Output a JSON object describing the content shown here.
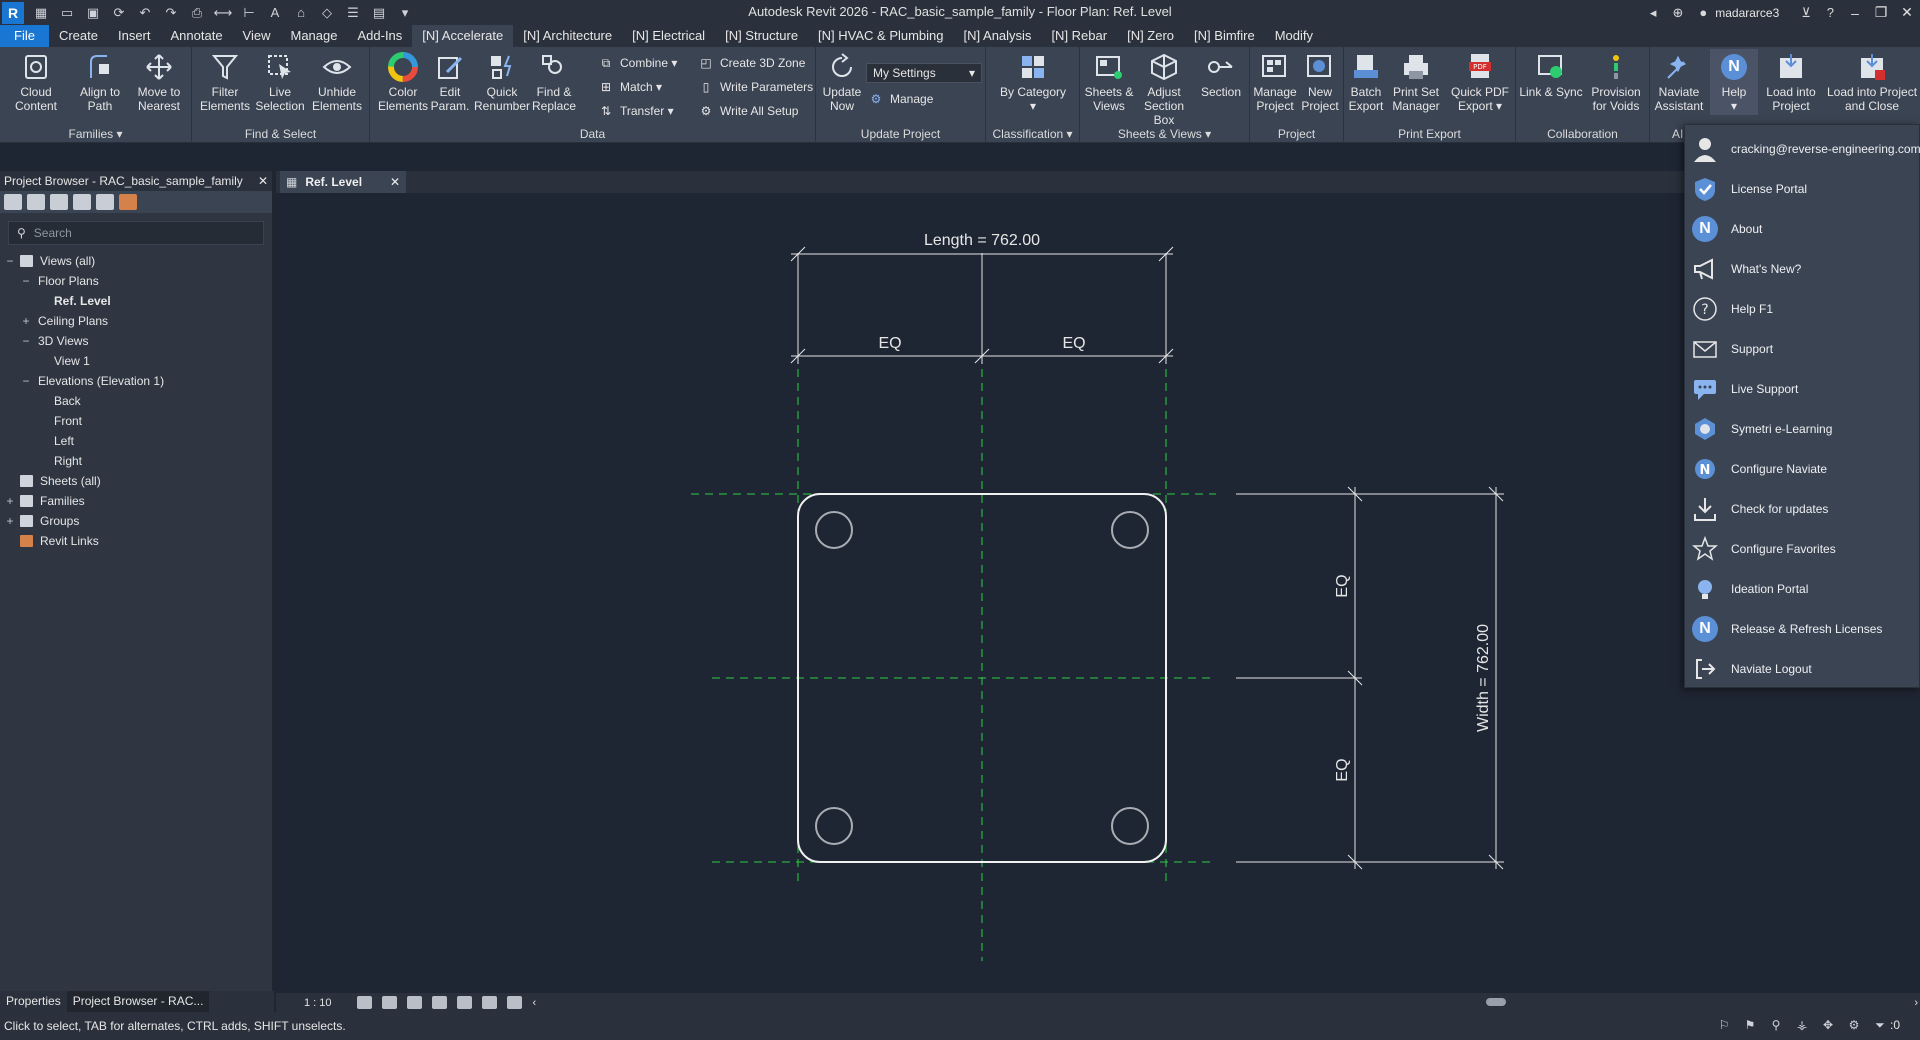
{
  "window": {
    "title": "Autodesk Revit 2026 - RAC_basic_sample_family - Floor Plan: Ref. Level",
    "user": "madararce3"
  },
  "menu_tabs": [
    "File",
    "Create",
    "Insert",
    "Annotate",
    "View",
    "Manage",
    "Add-Ins",
    "[N] Accelerate",
    "[N] Architecture",
    "[N] Electrical",
    "[N] Structure",
    "[N] HVAC & Plumbing",
    "[N] Analysis",
    "[N] Rebar",
    "[N] Zero",
    "[N] Bimfire",
    "Modify"
  ],
  "ribbon": {
    "families": {
      "label": "Families",
      "cloud_content": "Cloud Content",
      "align_to_path": "Align to Path",
      "move_to_nearest": "Move to Nearest"
    },
    "find_select": {
      "label": "Find & Select",
      "filter_elements": "Filter Elements",
      "live_selection": "Live Selection",
      "unhide_elements": "Unhide Elements"
    },
    "data": {
      "label": "Data",
      "color_elements": "Color Elements",
      "edit_param": "Edit Param.",
      "quick_renumber": "Quick Renumber",
      "find_replace": "Find & Replace",
      "combine": "Combine",
      "match": "Match",
      "transfer": "Transfer",
      "create_3d_zone": "Create 3D Zone",
      "write_parameters": "Write Parameters",
      "write_all_setup": "Write All Setup"
    },
    "update_project": {
      "label": "Update Project",
      "update_now": "Update Now",
      "settings_value": "My Settings",
      "manage": "Manage"
    },
    "classification": {
      "label": "Classification",
      "by_category": "By Category"
    },
    "sheets_views": {
      "label": "Sheets & Views",
      "sheets_views": "Sheets & Views",
      "adjust_section_box": "Adjust Section Box",
      "section": "Section"
    },
    "project": {
      "label": "Project",
      "manage_project": "Manage Project",
      "new_project": "New Project"
    },
    "print_export": {
      "label": "Print Export",
      "batch_export": "Batch Export",
      "print_set_manager": "Print Set Manager",
      "quick_pdf_export": "Quick PDF Export"
    },
    "collaboration": {
      "label": "Collaboration",
      "link_sync": "Link & Sync",
      "provision_voids": "Provision for Voids"
    },
    "ai": {
      "label": "AI",
      "naviate_assistant": "Naviate Assistant",
      "help": "Help",
      "load_into_project": "Load into Project",
      "load_into_project_close": "Load into Project and Close"
    }
  },
  "project_browser": {
    "title": "Project Browser - RAC_basic_sample_family",
    "search_placeholder": "Search",
    "tree": [
      {
        "label": "Views (all)",
        "level": 0,
        "exp": "−"
      },
      {
        "label": "Floor Plans",
        "level": 1,
        "exp": "−"
      },
      {
        "label": "Ref. Level",
        "level": 2,
        "exp": ""
      },
      {
        "label": "Ceiling Plans",
        "level": 1,
        "exp": "+"
      },
      {
        "label": "3D Views",
        "level": 1,
        "exp": "−"
      },
      {
        "label": "View 1",
        "level": 2,
        "exp": ""
      },
      {
        "label": "Elevations (Elevation 1)",
        "level": 1,
        "exp": "−"
      },
      {
        "label": "Back",
        "level": 2,
        "exp": ""
      },
      {
        "label": "Front",
        "level": 2,
        "exp": ""
      },
      {
        "label": "Left",
        "level": 2,
        "exp": ""
      },
      {
        "label": "Right",
        "level": 2,
        "exp": ""
      },
      {
        "label": "Sheets (all)",
        "level": 0,
        "exp": ""
      },
      {
        "label": "Families",
        "level": 0,
        "exp": "+"
      },
      {
        "label": "Groups",
        "level": 0,
        "exp": "+"
      },
      {
        "label": "Revit Links",
        "level": 0,
        "exp": ""
      }
    ],
    "selected": "Ref. Level"
  },
  "bottom_tabs": [
    "Properties",
    "Project Browser - RAC..."
  ],
  "view": {
    "tab_label": "Ref. Level",
    "dimensions": {
      "length": "Length = 762.00",
      "width": "Width = 762.00",
      "eq": "EQ"
    },
    "scale": "1 : 10"
  },
  "status": {
    "text": "Click to select, TAB for alternates, CTRL adds, SHIFT unselects.",
    "filter_count": ":0"
  },
  "help_menu": [
    {
      "label": "cracking@reverse-engineering.com",
      "icon": "user-icon"
    },
    {
      "label": "License Portal",
      "icon": "license-icon"
    },
    {
      "label": "About",
      "icon": "naviate-icon"
    },
    {
      "label": "What's New?",
      "icon": "megaphone-icon"
    },
    {
      "label": "Help F1",
      "icon": "question-icon"
    },
    {
      "label": "Support",
      "icon": "envelope-icon"
    },
    {
      "label": "Live Support",
      "icon": "chat-icon"
    },
    {
      "label": "Symetri e-Learning",
      "icon": "elearning-icon"
    },
    {
      "label": "Configure Naviate",
      "icon": "gear-icon"
    },
    {
      "label": "Check for updates",
      "icon": "download-icon"
    },
    {
      "label": "Configure Favorites",
      "icon": "star-icon"
    },
    {
      "label": "Ideation Portal",
      "icon": "lightbulb-icon"
    },
    {
      "label": "Release & Refresh Licenses",
      "icon": "naviate-icon"
    },
    {
      "label": "Naviate Logout",
      "icon": "logout-icon"
    }
  ]
}
